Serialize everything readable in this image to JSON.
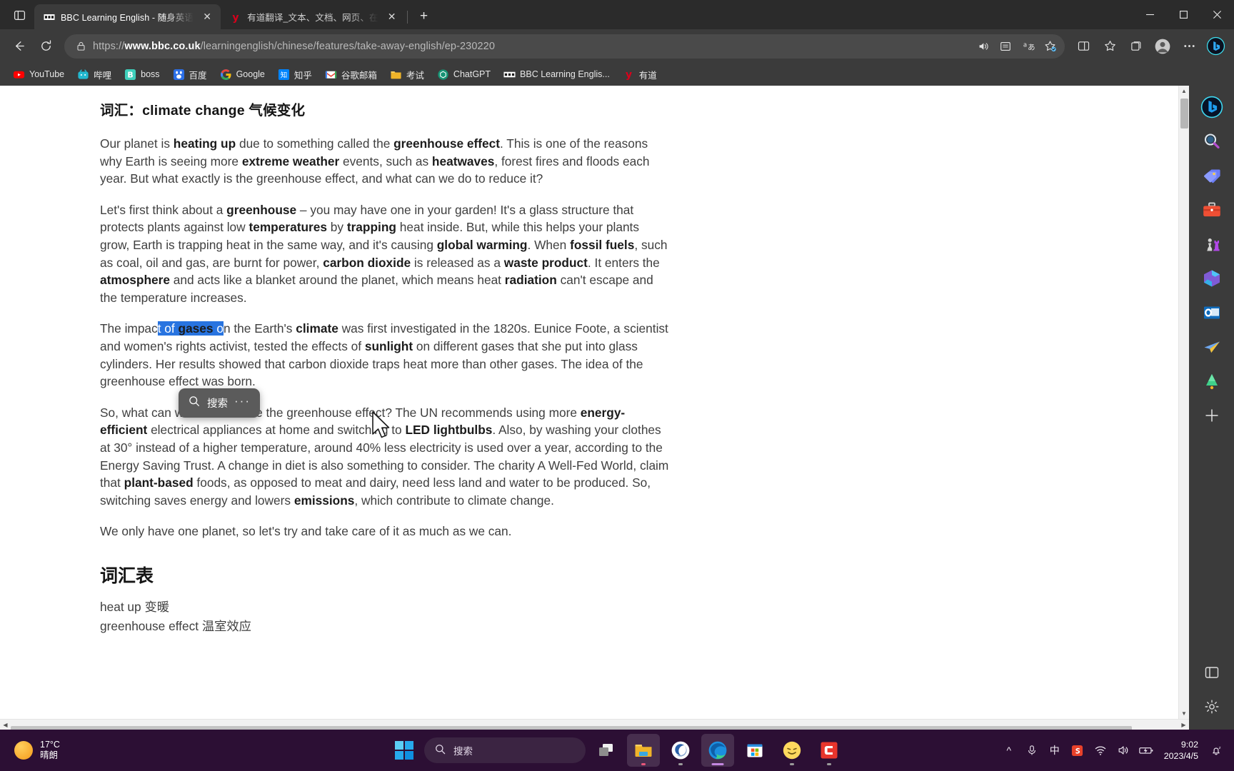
{
  "window": {
    "tab_list_icon": "tab-list-icon",
    "minimize": "–",
    "maximize": "▢",
    "close": "✕"
  },
  "tabs": [
    {
      "title": "BBC Learning English - 随身英语",
      "favicon": "bbc-icon",
      "active": true,
      "close": "✕"
    },
    {
      "title": "有道翻译_文本、文档、网页、在",
      "favicon": "youdao-icon",
      "active": false,
      "close": "✕"
    }
  ],
  "new_tab_label": "+",
  "nav": {
    "back_icon": "back-arrow-icon",
    "refresh_icon": "refresh-icon",
    "lock_icon": "lock-icon",
    "url_prefix": "https://",
    "url_domain": "www.bbc.co.uk",
    "url_path": "/learningenglish/chinese/features/take-away-english/ep-230220",
    "read_aloud_icon": "read-aloud-icon",
    "immersive_reader_icon": "immersive-reader-icon",
    "translate_icon": "translate-icon",
    "favorite_icon": "add-favorite-icon",
    "split_screen_icon": "split-screen-icon",
    "favorites_icon": "favorites-icon",
    "collections_icon": "collections-icon",
    "profile_icon": "profile-icon",
    "settings_more_icon": "more-settings-icon",
    "copilot_icon": "bing-copilot-icon"
  },
  "bookmarks": [
    {
      "label": "YouTube",
      "icon": "youtube-icon"
    },
    {
      "label": "哔哩",
      "icon": "bilibili-icon"
    },
    {
      "label": "boss",
      "icon": "boss-icon"
    },
    {
      "label": "百度",
      "icon": "baidu-icon"
    },
    {
      "label": "Google",
      "icon": "google-icon"
    },
    {
      "label": "知乎",
      "icon": "zhihu-icon"
    },
    {
      "label": "谷歌邮箱",
      "icon": "gmail-icon"
    },
    {
      "label": "考试",
      "icon": "folder-icon"
    },
    {
      "label": "ChatGPT",
      "icon": "chatgpt-icon"
    },
    {
      "label": "BBC Learning Englis...",
      "icon": "bbc-icon"
    },
    {
      "label": "有道",
      "icon": "youdao-icon"
    }
  ],
  "article": {
    "heading": "词汇：climate change 气候变化",
    "p1_a": "Our planet is ",
    "p1_b1": "heating up",
    "p1_b": " due to something called the ",
    "p1_b2": "greenhouse effect",
    "p1_c": ". This is one of the reasons why Earth is seeing more ",
    "p1_b3": "extreme weather",
    "p1_d": " events, such as ",
    "p1_b4": "heatwaves",
    "p1_e": ", forest fires and floods each year. But what exactly is the greenhouse effect, and what can we do to reduce it?",
    "p2_a": "Let's first think about a ",
    "p2_b1": "greenhouse",
    "p2_b": " – you may have one in your garden! It's a glass structure that protects plants against low ",
    "p2_b2": "temperatures",
    "p2_c": " by ",
    "p2_b3": "trapping",
    "p2_d": " heat inside. But, while this helps your plants grow, Earth is trapping heat in the same way, and it's causing ",
    "p2_b4": "global warming",
    "p2_e": ". When ",
    "p2_b5": "fossil fuels",
    "p2_f": ", such as coal, oil and gas, are burnt for power, ",
    "p2_b6": "carbon dioxide",
    "p2_g": " is released as a ",
    "p2_b7": "waste product",
    "p2_h": ". It enters the ",
    "p2_b8": "atmosphere",
    "p2_i": " and acts like a blanket around the planet, which means heat ",
    "p2_b9": "radiation",
    "p2_j": " can't escape and the temperature increases.",
    "p3_a": "The impac",
    "p3_sel_a": "t of ",
    "p3_sel_b": "gases",
    "p3_sel_c": " o",
    "p3_b": "n the Earth's ",
    "p3_b1": "climate",
    "p3_c": " was first investigated in the 1820s. Eunice Foote, a scientist and women's rights activist, tested the effects of ",
    "p3_b2": "sunlight",
    "p3_d": " on different gases that she put into glass cylinders. Her results showed that carbon dioxide traps heat more than other gases. The idea of the greenhouse effect was born.",
    "p4_a": "So, what can we do to reduce the greenhouse effect? The UN recommends using more ",
    "p4_b1": "energy-efficient",
    "p4_b": " electrical appliances at home and switching to ",
    "p4_b2": "LED lightbulbs",
    "p4_c": ". Also, by washing your clothes at 30° instead of a higher temperature, around 40% less electricity is used over a year, according to the Energy Saving Trust. A change in diet is also something to consider. The charity A Well-Fed World, claim that ",
    "p4_b3": "plant-based",
    "p4_d": " foods, as opposed to meat and dairy, need less land and water to be produced. So, switching saves energy and lowers ",
    "p4_b4": "emissions",
    "p4_e": ", which contribute to climate change.",
    "p5": "We only have one planet, so let's try and take care of it as much as we can.",
    "vocab_heading": "词汇表",
    "vocab_1": "heat up 变暖",
    "vocab_2": "greenhouse effect 温室效应"
  },
  "mini_toolbar": {
    "search_icon": "search-icon",
    "search_label": "搜索",
    "more_label": "···"
  },
  "edge_sidebar": [
    {
      "name": "bing-copilot-icon"
    },
    {
      "name": "search-icon"
    },
    {
      "name": "shopping-tag-icon"
    },
    {
      "name": "toolbox-icon"
    },
    {
      "name": "games-icon"
    },
    {
      "name": "microsoft-365-icon"
    },
    {
      "name": "outlook-icon"
    },
    {
      "name": "paper-plane-icon"
    },
    {
      "name": "tree-icon"
    },
    {
      "name": "add-sidebar-icon"
    }
  ],
  "edge_sidebar_bottom": [
    {
      "name": "browser-essentials-icon"
    },
    {
      "name": "sidebar-settings-icon"
    }
  ],
  "taskbar": {
    "weather_temp": "17°C",
    "weather_desc": "晴朗",
    "start_icon": "windows-start-icon",
    "search_placeholder": "搜索",
    "search_icon": "search-icon",
    "apps": [
      {
        "name": "task-view-icon"
      },
      {
        "name": "file-explorer-icon"
      },
      {
        "name": "sogou-icon"
      },
      {
        "name": "microsoft-edge-icon"
      },
      {
        "name": "microsoft-store-icon"
      },
      {
        "name": "emoji-app-icon"
      },
      {
        "name": "camtasia-icon"
      }
    ],
    "tray": {
      "chevron": "^",
      "mic_icon": "microphone-icon",
      "ime_label": "中",
      "sogou_icon": "sogou-tray-icon",
      "wifi_icon": "wifi-icon",
      "volume_icon": "volume-icon",
      "battery_icon": "battery-icon",
      "notification_icon": "notification-bell-icon"
    },
    "time": "9:02",
    "date": "2023/4/5"
  }
}
